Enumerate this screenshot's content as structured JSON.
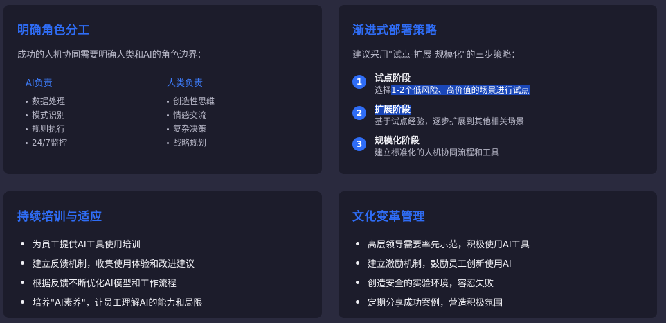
{
  "roles_card": {
    "title": "明确角色分工",
    "intro": "成功的人机协同需要明确人类和AI的角色边界：",
    "ai": {
      "heading": "AI负责",
      "items": [
        "数据处理",
        "模式识别",
        "规则执行",
        "24/7监控"
      ]
    },
    "human": {
      "heading": "人类负责",
      "items": [
        "创造性思维",
        "情感交流",
        "复杂决策",
        "战略规划"
      ]
    }
  },
  "deploy_card": {
    "title": "渐进式部署策略",
    "intro": "建议采用\"试点-扩展-规模化\"的三步策略：",
    "steps": [
      {
        "num": "1",
        "title": "试点阶段",
        "desc_prefix": "选择",
        "desc_highlight": "1-2个低风险、高价值的场景进行试点"
      },
      {
        "num": "2",
        "title": "扩展阶段",
        "desc": "基于试点经验，逐步扩展到其他相关场景"
      },
      {
        "num": "3",
        "title": "规模化阶段",
        "desc": "建立标准化的人机协同流程和工具"
      }
    ]
  },
  "training_card": {
    "title": "持续培训与适应",
    "items": [
      "为员工提供AI工具使用培训",
      "建立反馈机制，收集使用体验和改进建议",
      "根据反馈不断优化AI模型和工作流程",
      "培养\"AI素养\"，让员工理解AI的能力和局限"
    ]
  },
  "culture_card": {
    "title": "文化变革管理",
    "items": [
      "高层领导需要率先示范，积极使用AI工具",
      "建立激励机制，鼓励员工创新使用AI",
      "创造安全的实验环境，容忍失败",
      "定期分享成功案例，营造积极氛围"
    ]
  },
  "colors": {
    "accent": "#2f6df6",
    "card_bg": "#1c1c2b",
    "page_bg": "#2a2a3e",
    "highlight_bg": "#1a47b8"
  }
}
